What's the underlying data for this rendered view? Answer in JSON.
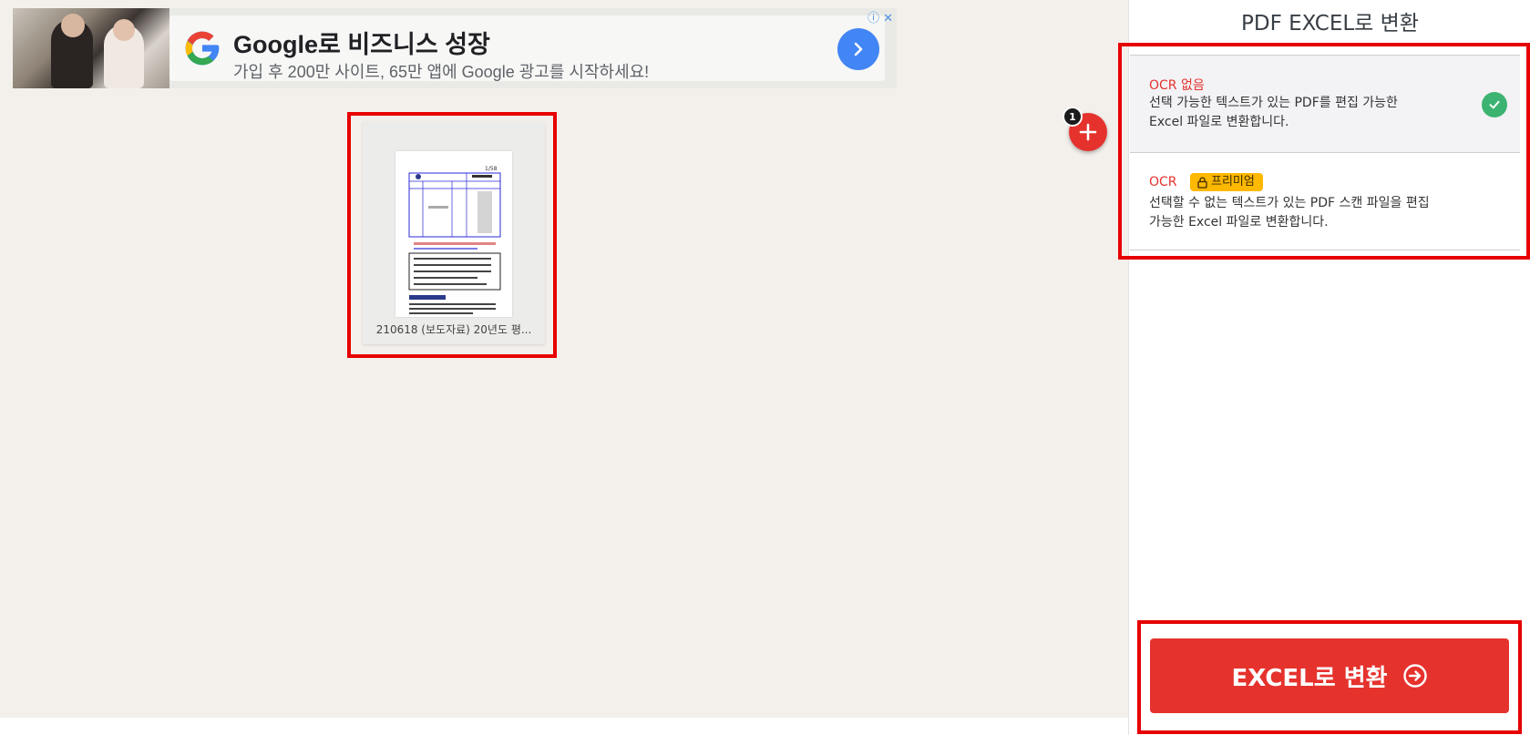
{
  "ad": {
    "title": "Google로 비즈니스 성장",
    "subtitle": "가입 후 200만 사이트, 65만 앱에 Google 광고를 시작하세요!"
  },
  "file": {
    "name": "210618 (보도자료) 20년도 평...",
    "count_badge": "1"
  },
  "panel": {
    "title": "PDF EXCEL로 변환",
    "options": [
      {
        "name": "OCR 없음",
        "description_line1": "선택 가능한 텍스트가 있는 PDF를 편집 가능한",
        "description_line2": "Excel 파일로 변환합니다.",
        "selected": true
      },
      {
        "name": "OCR",
        "badge": "프리미엄",
        "description_line1": "선택할 수 없는 텍스트가 있는 PDF 스캔 파일을 편집",
        "description_line2": "가능한 Excel 파일로 변환합니다.",
        "selected": false
      }
    ],
    "convert_button": "EXCEL로 변환"
  },
  "colors": {
    "accent": "#e5322d",
    "workspace_bg": "#f3f0ec",
    "premium_badge": "#ffb800",
    "check": "#3cb371",
    "highlight": "#e60000"
  }
}
